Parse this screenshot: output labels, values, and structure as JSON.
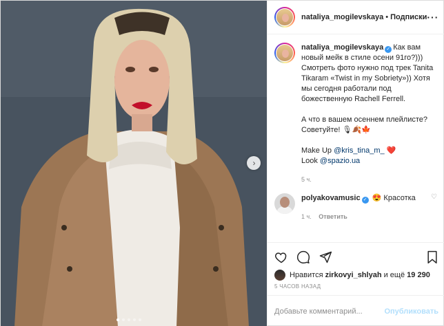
{
  "post": {
    "username": "nataliya_mogilevskaya",
    "separator": "•",
    "follow_label": "Подписки",
    "more_icon": "more-horizontal-icon"
  },
  "caption": {
    "username": "nataliya_mogilevskaya",
    "line1": "Как вам новый мейк в стиле осени 91го?))) Смотреть фото нужно под трек Tanita Tikaram «Twist in my Sobriety»)) Хотя мы сегодня работали под божественную Rachell Ferrell.",
    "line2": "А что в вашем осеннем плейлисте? Советуйте! 🎙🍂🍁",
    "makeup_label": "Make Up",
    "makeup_link": "@kris_tina_m_",
    "makeup_emoji": "❤️",
    "look_label": "Look",
    "look_link": "@spazio.ua",
    "time": "5 ч."
  },
  "comment": {
    "username": "polyakovamusic",
    "emoji": "😍",
    "text": "Красотка",
    "time": "1 ч.",
    "reply_label": "Ответить"
  },
  "likes": {
    "prefix": "Нравится",
    "user": "zirkovyi_shlyah",
    "and": "и ещё",
    "count": "19 290"
  },
  "timestamp": "5 ЧАСОВ НАЗАД",
  "add_comment": {
    "placeholder": "Добавьте комментарий...",
    "publish_label": "Опубликовать"
  },
  "carousel": {
    "slide_count": 5,
    "active_index": 0
  },
  "colors": {
    "verified": "#3897f0",
    "link": "#00376b",
    "muted": "#8e8e8e",
    "publish": "#b2dffc",
    "heart": "#ed4956"
  }
}
